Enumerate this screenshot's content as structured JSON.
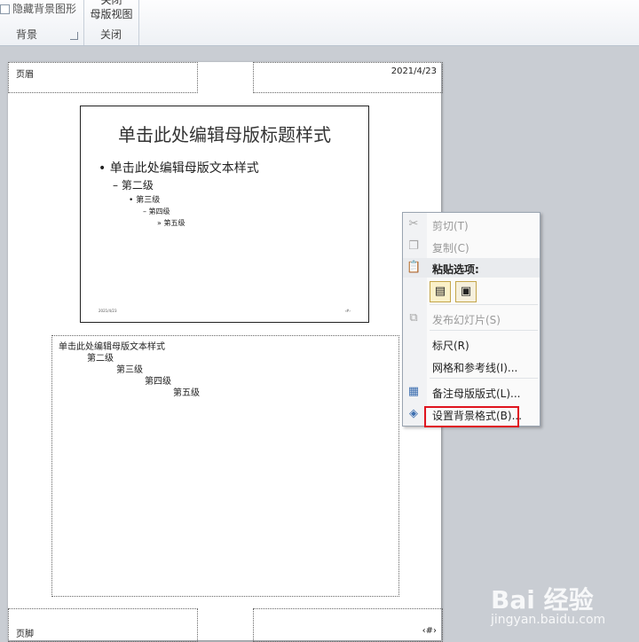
{
  "ribbon": {
    "hide_background_label": "隐藏背景图形",
    "background_group_label": "背景",
    "close_line1": "关闭",
    "close_line2": "母版视图",
    "close_group_label": "关闭"
  },
  "page": {
    "header_text": "页眉",
    "date_text": "2021/4/23",
    "footer_text": "页脚",
    "page_number": "‹#›"
  },
  "slide": {
    "title": "单击此处编辑母版标题样式",
    "levels": [
      "单击此处编辑母版文本样式",
      "第二级",
      "第三级",
      "第四级",
      "第五级"
    ],
    "bullets": [
      "•",
      "–",
      "•",
      "–",
      "»"
    ],
    "footer_date": "2021/4/23",
    "footer_num": "‹#›"
  },
  "notes": {
    "levels": [
      "单击此处编辑母版文本样式",
      "第二级",
      "第三级",
      "第四级",
      "第五级"
    ]
  },
  "context_menu": {
    "cut": "剪切(T)",
    "copy": "复制(C)",
    "paste_options": "粘贴选项:",
    "publish": "发布幻灯片(S)",
    "ruler": "标尺(R)",
    "grid": "网格和参考线(I)...",
    "notes_master_layout": "备注母版版式(L)...",
    "format_background": "设置背景格式(B)..."
  },
  "watermark": {
    "logo": "Bai 经验",
    "url": "jingyan.baidu.com"
  }
}
